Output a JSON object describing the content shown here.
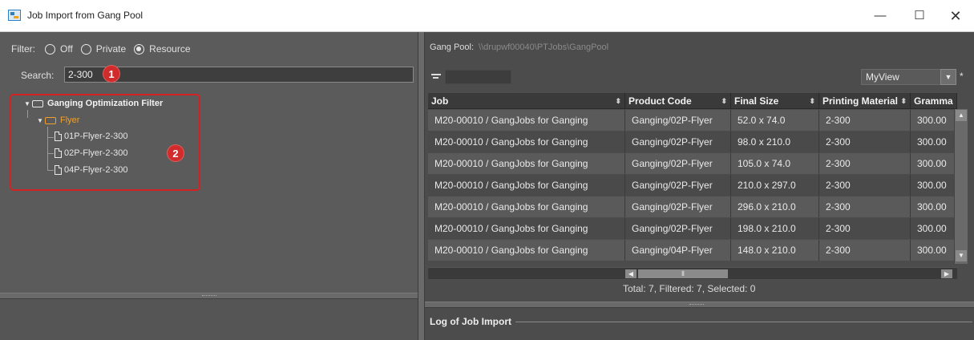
{
  "window": {
    "title": "Job Import from Gang Pool",
    "controls": {
      "minimize": "—",
      "maximize": "☐",
      "close": "✕"
    }
  },
  "filter": {
    "label": "Filter:",
    "options": [
      {
        "label": "Off",
        "selected": false
      },
      {
        "label": "Private",
        "selected": false
      },
      {
        "label": "Resource",
        "selected": true
      }
    ]
  },
  "search": {
    "label": "Search:",
    "value": "2-300"
  },
  "badges": {
    "one": "1",
    "two": "2"
  },
  "tree": {
    "root": "Ganging Optimization Filter",
    "group": "Flyer",
    "items": [
      "01P-Flyer-2-300",
      "02P-Flyer-2-300",
      "04P-Flyer-2-300"
    ]
  },
  "gang_pool": {
    "label": "Gang Pool:",
    "path": "\\\\drupwf00040\\PTJobs\\GangPool"
  },
  "view": {
    "selected": "MyView",
    "modified": "*"
  },
  "table": {
    "columns": [
      "Job",
      "Product Code",
      "Final Size",
      "Printing Material",
      "Gramma"
    ],
    "rows": [
      [
        "M20-00010 / GangJobs for Ganging",
        "Ganging/02P-Flyer",
        "52.0 x 74.0",
        "2-300",
        "300.00"
      ],
      [
        "M20-00010 / GangJobs for Ganging",
        "Ganging/02P-Flyer",
        "98.0 x 210.0",
        "2-300",
        "300.00"
      ],
      [
        "M20-00010 / GangJobs for Ganging",
        "Ganging/02P-Flyer",
        "105.0 x 74.0",
        "2-300",
        "300.00"
      ],
      [
        "M20-00010 / GangJobs for Ganging",
        "Ganging/02P-Flyer",
        "210.0 x 297.0",
        "2-300",
        "300.00"
      ],
      [
        "M20-00010 / GangJobs for Ganging",
        "Ganging/02P-Flyer",
        "296.0 x 210.0",
        "2-300",
        "300.00"
      ],
      [
        "M20-00010 / GangJobs for Ganging",
        "Ganging/02P-Flyer",
        "198.0 x 210.0",
        "2-300",
        "300.00"
      ],
      [
        "M20-00010 / GangJobs for Ganging",
        "Ganging/04P-Flyer",
        "148.0 x 210.0",
        "2-300",
        "300.00"
      ]
    ]
  },
  "totals": "Total: 7,   Filtered: 7,   Selected: 0",
  "log": {
    "title": "Log of Job Import"
  },
  "colors": {
    "accent_red": "#d42222",
    "flyer_orange": "#f0a030"
  }
}
